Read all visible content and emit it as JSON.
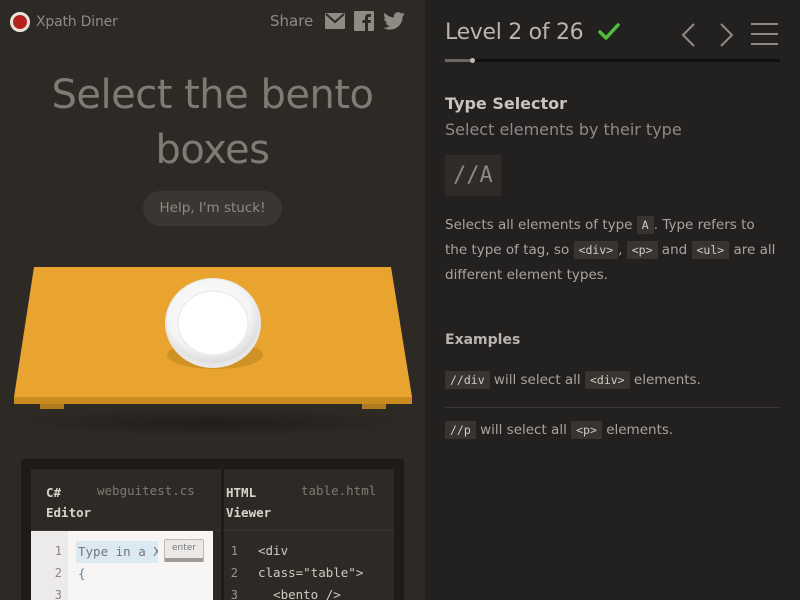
{
  "app": {
    "name": "Xpath Diner",
    "share_label": "Share"
  },
  "game": {
    "instruction_line1": "Select the bento",
    "instruction_line2": "boxes",
    "help_label": "Help, I'm stuck!"
  },
  "editor": {
    "left_title_line1": "C#",
    "left_title_line2": "Editor",
    "left_file": "webguitest.cs",
    "input_placeholder": "Type in a XPath selector",
    "enter_label": "enter",
    "left_line_numbers": [
      "1",
      "2",
      "3"
    ],
    "left_code_line2": "{",
    "right_title_line1": "HTML",
    "right_title_line2": "Viewer",
    "right_file": "table.html",
    "right_line_numbers": [
      "1",
      "2",
      "3"
    ],
    "html_lines": [
      "<div",
      "class=\"table\">",
      "  <bento />"
    ]
  },
  "level": {
    "text": "Level 2 of 26",
    "completed": true,
    "progress_fraction": 0.08
  },
  "selector": {
    "title": "Type Selector",
    "subtitle": "Select elements by their type",
    "syntax": "//A",
    "desc_part1": "Selects all elements of type ",
    "desc_code1": "A",
    "desc_part2": ". Type refers to the type of tag, so ",
    "desc_code2": "<div>",
    "desc_part3": ", ",
    "desc_code3": "<p>",
    "desc_part4": " and ",
    "desc_code4": "<ul>",
    "desc_part5": " are all different element types."
  },
  "examples": {
    "title": "Examples",
    "items": [
      {
        "code": "//div",
        "text1": " will select all ",
        "code2": "<div>",
        "text2": " elements."
      },
      {
        "code": "//p",
        "text1": " will select all ",
        "code2": "<p>",
        "text2": " elements."
      }
    ]
  },
  "colors": {
    "table": "#e8a42e",
    "check": "#4fbf3a",
    "logo": "#b3201d"
  }
}
